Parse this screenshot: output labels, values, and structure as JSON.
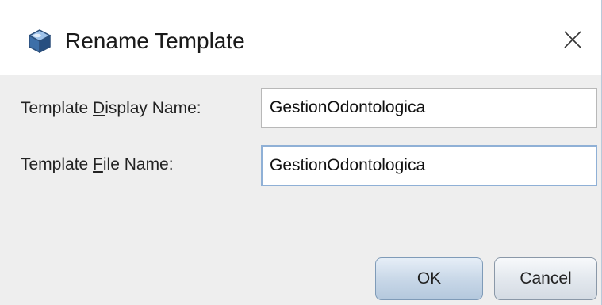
{
  "window": {
    "title": "Rename Template",
    "app_icon": "cube-icon",
    "close_icon": "close-icon"
  },
  "form": {
    "display_name": {
      "label_prefix": "Template ",
      "label_mnemonic": "D",
      "label_suffix": "isplay Name:",
      "value": "GestionOdontologica"
    },
    "file_name": {
      "label_prefix": "Template ",
      "label_mnemonic": "F",
      "label_suffix": "ile Name:",
      "value": "GestionOdontologica"
    }
  },
  "buttons": {
    "ok_label": "OK",
    "cancel_label": "Cancel"
  },
  "colors": {
    "dialog_background": "#eeeeee",
    "titlebar_background": "#ffffff",
    "focused_border": "#8fb0d6",
    "ok_button_gradient_mid": "#c9d8e8"
  }
}
